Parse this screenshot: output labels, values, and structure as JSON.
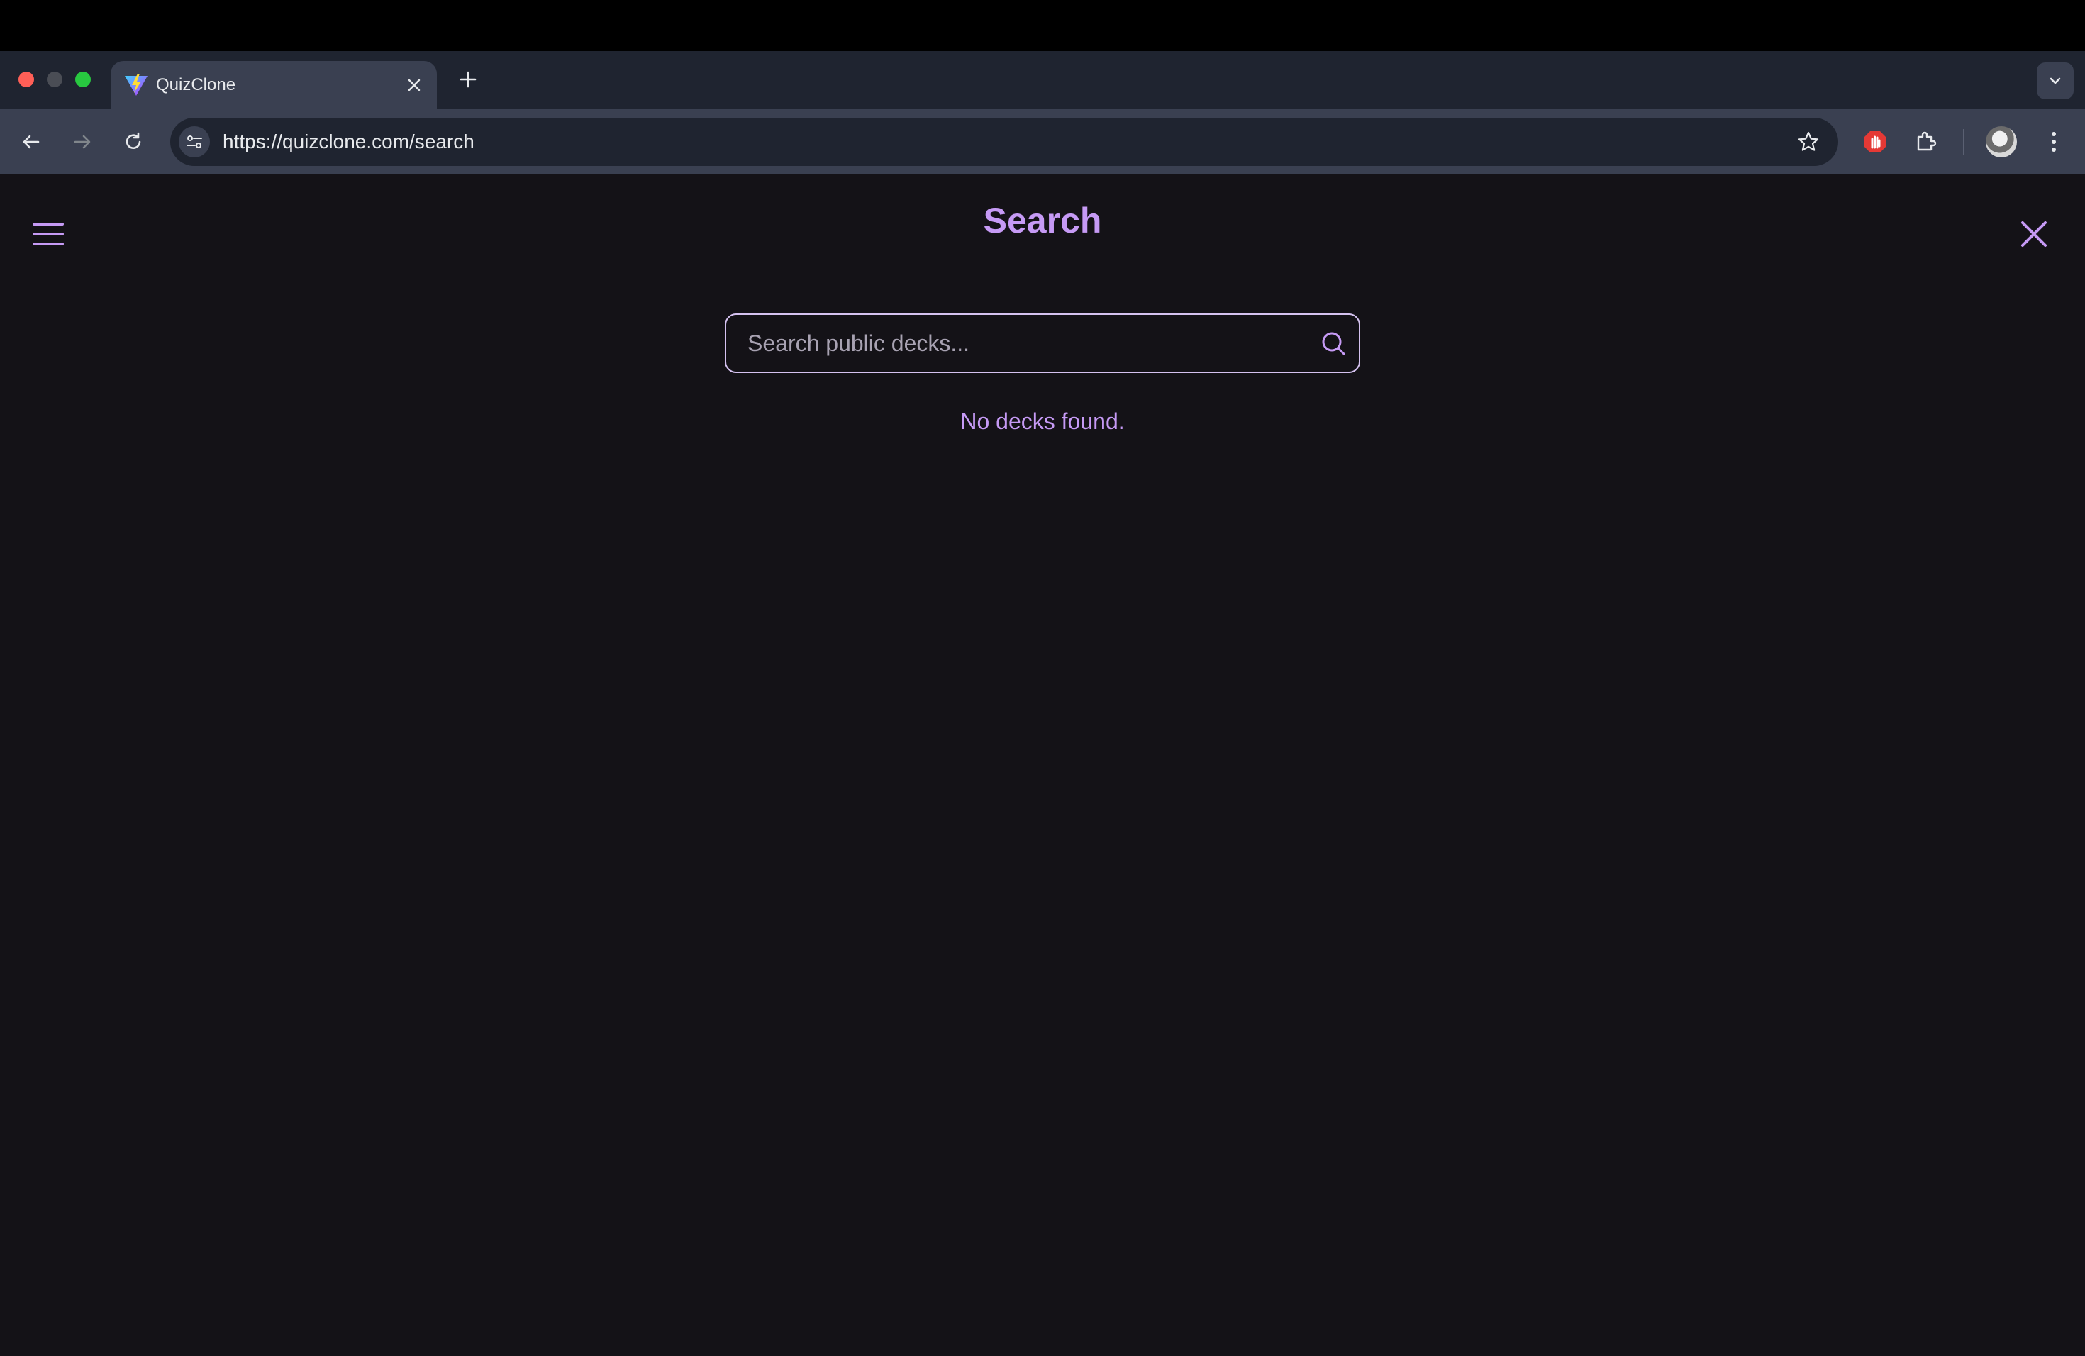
{
  "browser": {
    "tab": {
      "title": "QuizClone"
    },
    "url": "https://quizclone.com/search"
  },
  "page": {
    "title": "Search",
    "search": {
      "placeholder": "Search public decks...",
      "value": ""
    },
    "empty_message": "No decks found."
  },
  "colors": {
    "accent": "#c69af5",
    "background": "#141217",
    "input_border": "#d5c2f0"
  },
  "icons": [
    "menu-icon",
    "close-icon",
    "search-icon",
    "back-icon",
    "forward-icon",
    "reload-icon",
    "star-icon",
    "extensions-icon"
  ]
}
